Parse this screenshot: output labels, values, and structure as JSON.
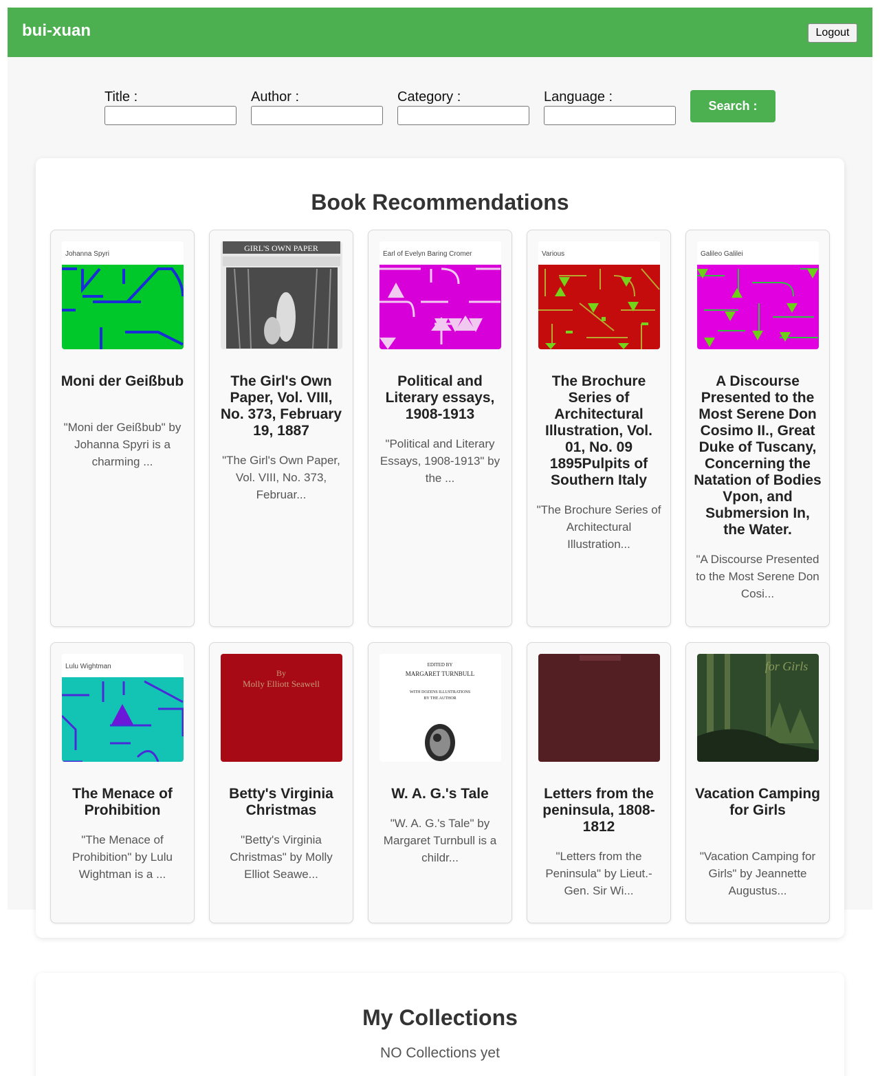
{
  "header": {
    "brand": "bui-xuan",
    "logout_label": "Logout"
  },
  "search": {
    "title_label": "Title :",
    "author_label": "Author :",
    "category_label": "Category :",
    "language_label": "Language :",
    "title_value": "",
    "author_value": "",
    "category_value": "",
    "language_value": "",
    "button_label": "Search :"
  },
  "recommendations": {
    "heading": "Book Recommendations",
    "books": [
      {
        "title": "Moni der Geißbub",
        "description": "\"Moni der Geißbub\" by Johanna Spyri is a charming ...",
        "cover_author": "Johanna Spyri",
        "cover_color": "#00c72a"
      },
      {
        "title": "The Girl's Own Paper, Vol. VIII, No. 373, February 19, 1887",
        "description": "\"The Girl's Own Paper, Vol. VIII, No. 373, Februar...",
        "cover_author": "",
        "cover_color": "#6a6a6a"
      },
      {
        "title": "Political and Literary essays, 1908-1913",
        "description": "\"Political and Literary Essays, 1908-1913\" by the ...",
        "cover_author": "Earl of Evelyn Baring Cromer",
        "cover_color": "#d800d8"
      },
      {
        "title": "The Brochure Series of Architectural Illustration, Vol. 01, No. 09 1895Pulpits of Southern Italy",
        "description": "\"The Brochure Series of Architectural Illustration...",
        "cover_author": "Various",
        "cover_color": "#c40c0c"
      },
      {
        "title": "A Discourse Presented to the Most Serene Don Cosimo II., Great Duke of Tuscany, Concerning the Natation of Bodies Vpon, and Submersion In, the Water.",
        "description": "\"A Discourse Presented to the Most Serene Don Cosi...",
        "cover_author": "Galileo Galilei",
        "cover_color": "#e000e0"
      },
      {
        "title": "The Menace of Prohibition",
        "description": "\"The Menace of Prohibition\" by Lulu Wightman is a ...",
        "cover_author": "Lulu Wightman",
        "cover_color": "#13c4b4"
      },
      {
        "title": "Betty's Virginia Christmas",
        "description": "\"Betty's Virginia Christmas\" by Molly Elliot Seawe...",
        "cover_author": "By\nMolly Elliott Seawell",
        "cover_color": "#a70a14"
      },
      {
        "title": "W. A. G.'s Tale",
        "description": "\"W. A. G.'s Tale\" by Margaret Turnbull is a childr...",
        "cover_author": "EDITED BY\nMARGARET TURNBULL\nWITH DOZENS ILLUSTRATIONS\nBY THE AUTHOR",
        "cover_color": "#ffffff"
      },
      {
        "title": "Letters from the peninsula, 1808-1812",
        "description": "\"Letters from the Peninsula\" by Lieut.-Gen. Sir Wi...",
        "cover_author": "",
        "cover_color": "#5a2226"
      },
      {
        "title": "Vacation Camping for Girls",
        "description": "\"Vacation Camping for Girls\" by Jeannette Augustus...",
        "cover_author": "",
        "cover_color": "#2f4a2b"
      }
    ]
  },
  "collections": {
    "heading": "My Collections",
    "empty_message": "NO Collections yet"
  }
}
